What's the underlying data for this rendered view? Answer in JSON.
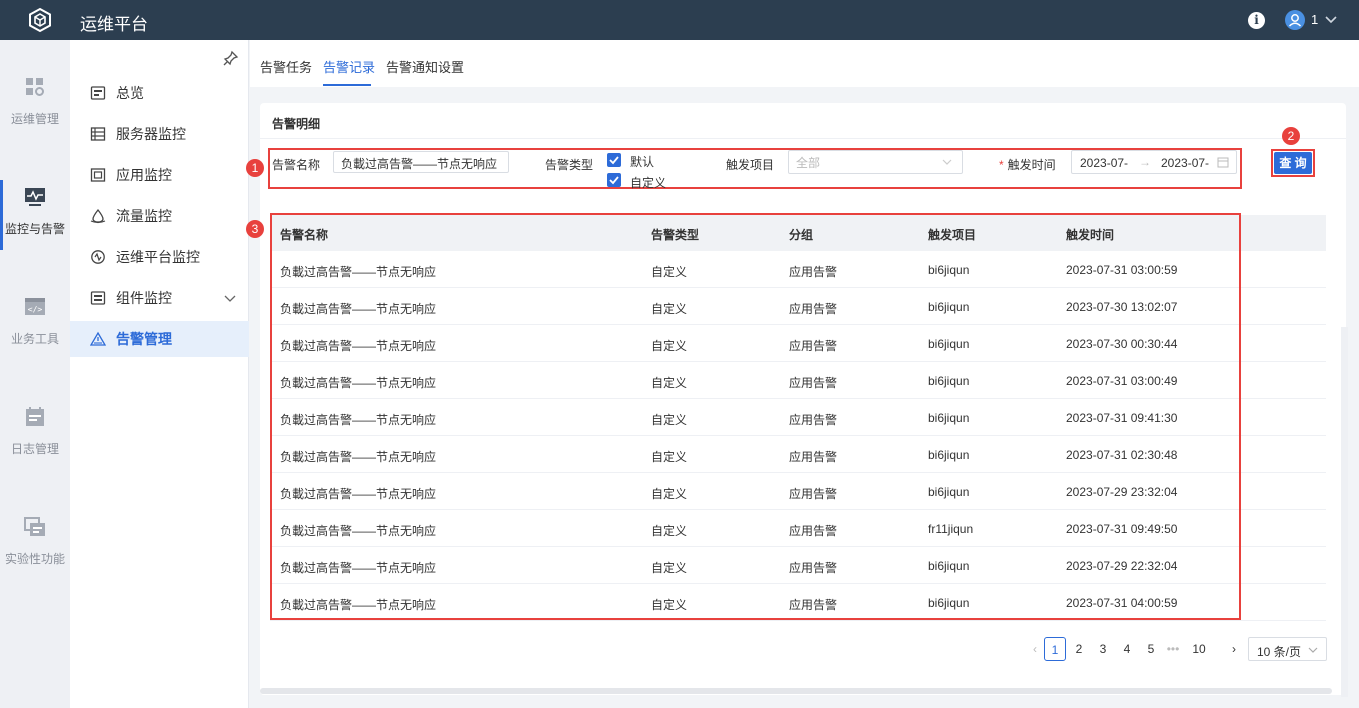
{
  "app": {
    "title": "运维平台",
    "user": "1"
  },
  "rail": [
    {
      "label": "运维管理",
      "icon": "grid-settings-icon"
    },
    {
      "label": "监控与告警",
      "icon": "monitor-icon"
    },
    {
      "label": "业务工具",
      "icon": "code-window-icon"
    },
    {
      "label": "日志管理",
      "icon": "calendar-log-icon"
    },
    {
      "label": "实验性功能",
      "icon": "stacked-window-icon"
    }
  ],
  "submenu": [
    {
      "label": "总览",
      "icon": "overview-icon"
    },
    {
      "label": "服务器监控",
      "icon": "server-icon"
    },
    {
      "label": "应用监控",
      "icon": "app-icon"
    },
    {
      "label": "流量监控",
      "icon": "traffic-icon"
    },
    {
      "label": "运维平台监控",
      "icon": "platform-icon"
    },
    {
      "label": "组件监控",
      "icon": "component-icon"
    },
    {
      "label": "告警管理",
      "icon": "alert-icon"
    }
  ],
  "tabs": [
    "告警任务",
    "告警记录",
    "告警通知设置"
  ],
  "card": {
    "title": "告警明细"
  },
  "filters": {
    "name_label": "告警名称",
    "name_value": "负載过高告警——节点无响应",
    "type_label": "告警类型",
    "type_options": [
      "默认",
      "自定义"
    ],
    "project_label": "触发项目",
    "project_placeholder": "全部",
    "time_label": "触发时间",
    "time_required": "*",
    "time_start": "2023-07-",
    "time_end": "2023-07-",
    "query_label": "查 询"
  },
  "badges": [
    "1",
    "2",
    "3"
  ],
  "table": {
    "headers": [
      "告警名称",
      "告警类型",
      "分组",
      "触发项目",
      "触发时间"
    ],
    "rows": [
      [
        "负載过高告警——节点无响应",
        "自定义",
        "应用告警",
        "bi6jiqun",
        "2023-07-31 03:00:59"
      ],
      [
        "负載过高告警——节点无响应",
        "自定义",
        "应用告警",
        "bi6jiqun",
        "2023-07-30 13:02:07"
      ],
      [
        "负載过高告警——节点无响应",
        "自定义",
        "应用告警",
        "bi6jiqun",
        "2023-07-30 00:30:44"
      ],
      [
        "负載过高告警——节点无响应",
        "自定义",
        "应用告警",
        "bi6jiqun",
        "2023-07-31 03:00:49"
      ],
      [
        "负載过高告警——节点无响应",
        "自定义",
        "应用告警",
        "bi6jiqun",
        "2023-07-31 09:41:30"
      ],
      [
        "负載过高告警——节点无响应",
        "自定义",
        "应用告警",
        "bi6jiqun",
        "2023-07-31 02:30:48"
      ],
      [
        "负載过高告警——节点无响应",
        "自定义",
        "应用告警",
        "bi6jiqun",
        "2023-07-29 23:32:04"
      ],
      [
        "负載过高告警——节点无响应",
        "自定义",
        "应用告警",
        "fr11jiqun",
        "2023-07-31 09:49:50"
      ],
      [
        "负載过高告警——节点无响应",
        "自定义",
        "应用告警",
        "bi6jiqun",
        "2023-07-29 22:32:04"
      ],
      [
        "负載过高告警——节点无响应",
        "自定义",
        "应用告警",
        "bi6jiqun",
        "2023-07-31 04:00:59"
      ]
    ]
  },
  "pagination": {
    "pages": [
      "1",
      "2",
      "3",
      "4",
      "5",
      "•••",
      "10"
    ],
    "current": "1",
    "page_size": "10 条/页"
  },
  "colors": {
    "accent": "#2d6bd8",
    "topbar": "#2c3e50",
    "annotation": "#e8413d"
  }
}
